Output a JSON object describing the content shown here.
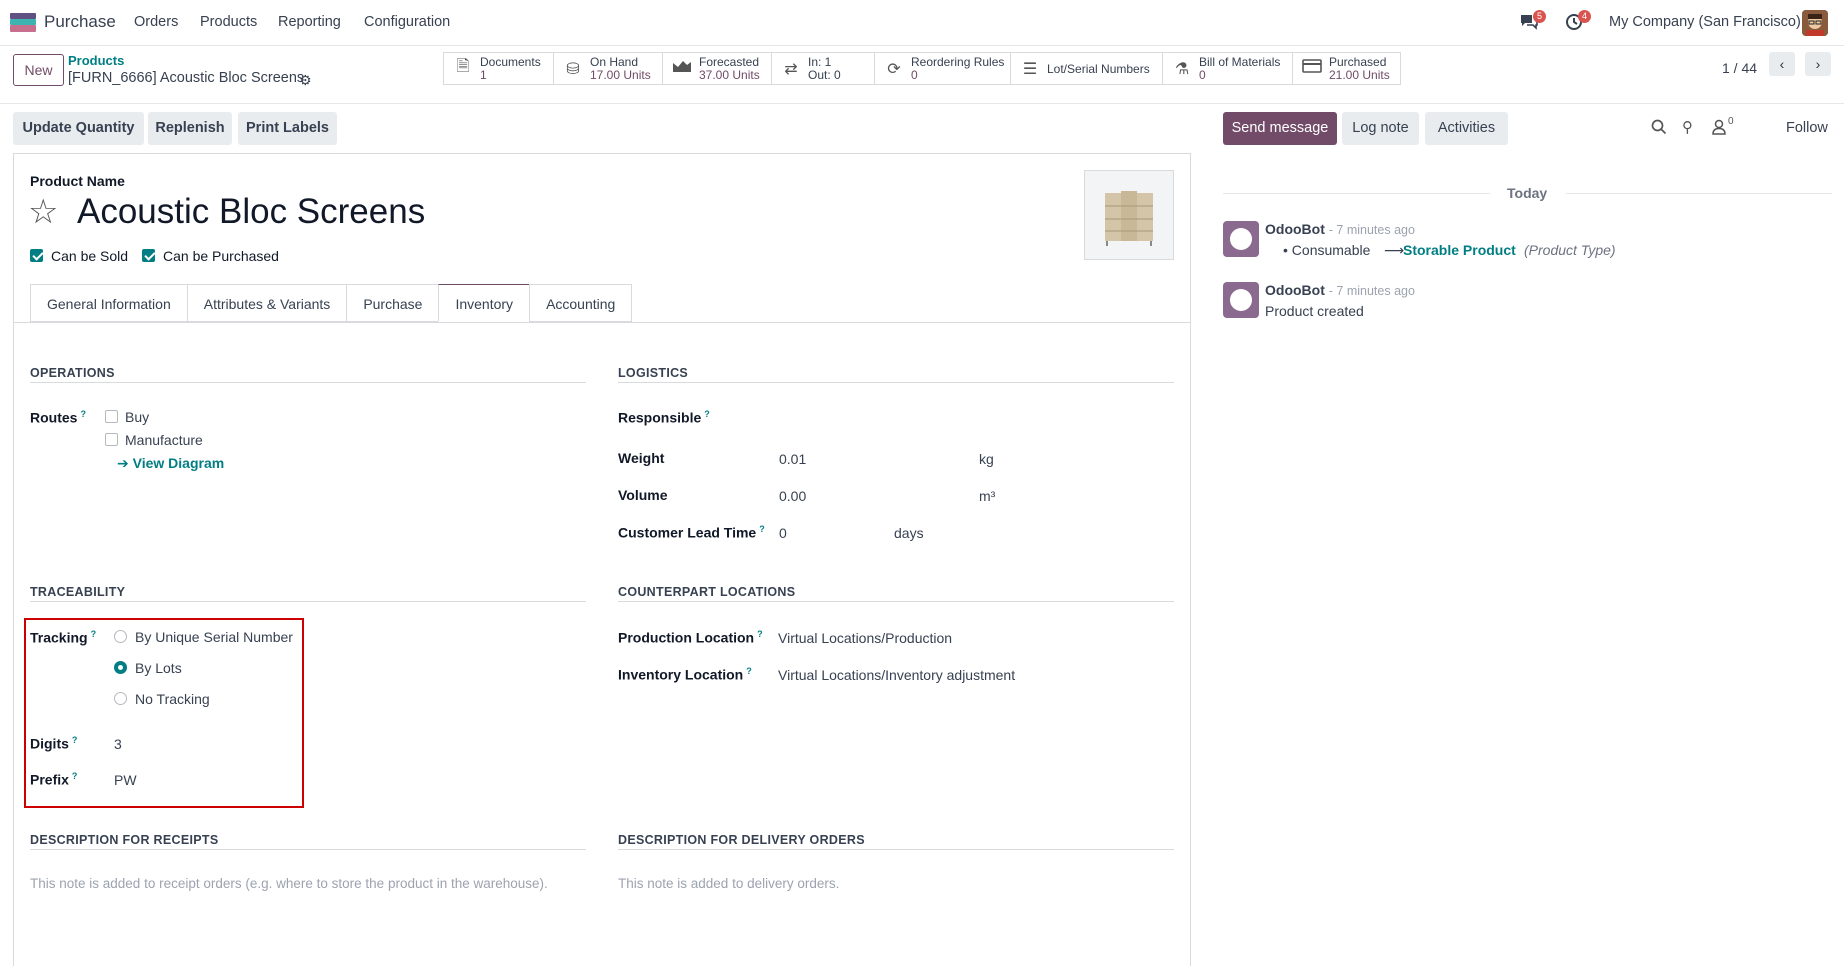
{
  "topbar": {
    "app_name": "Purchase",
    "menu": [
      "Orders",
      "Products",
      "Reporting",
      "Configuration"
    ],
    "messages_badge": "5",
    "activities_badge": "4",
    "company": "My Company (San Francisco)"
  },
  "control_panel": {
    "new_label": "New",
    "breadcrumb_parent": "Products",
    "breadcrumb_current": "[FURN_6666] Acoustic Bloc Screens",
    "smart_buttons": [
      {
        "label": "Documents",
        "value": "1",
        "icon": "document-icon"
      },
      {
        "label": "On Hand",
        "value": "17.00 Units",
        "icon": "cubes-icon"
      },
      {
        "label": "Forecasted",
        "value": "37.00 Units",
        "icon": "area-chart-icon"
      },
      {
        "label": "In: 1",
        "value": "Out: 0",
        "icon": "exchange-icon"
      },
      {
        "label": "Reordering Rules",
        "value": "0",
        "icon": "refresh-icon"
      },
      {
        "label": "Lot/Serial Numbers",
        "value": "",
        "icon": "list-icon"
      },
      {
        "label": "Bill of Materials",
        "value": "0",
        "icon": "flask-icon"
      },
      {
        "label": "Purchased",
        "value": "21.00 Units",
        "icon": "credit-card-icon"
      }
    ],
    "pager": "1 / 44"
  },
  "actions": {
    "update_quantity": "Update Quantity",
    "replenish": "Replenish",
    "print_labels": "Print Labels"
  },
  "product": {
    "name_label": "Product Name",
    "name": "Acoustic Bloc Screens",
    "can_be_sold": "Can be Sold",
    "can_be_purchased": "Can be Purchased"
  },
  "tabs": [
    "General Information",
    "Attributes & Variants",
    "Purchase",
    "Inventory",
    "Accounting"
  ],
  "operations": {
    "title": "OPERATIONS",
    "routes_label": "Routes",
    "route_buy": "Buy",
    "route_manufacture": "Manufacture",
    "view_diagram": "View Diagram"
  },
  "logistics": {
    "title": "LOGISTICS",
    "responsible_label": "Responsible",
    "weight_label": "Weight",
    "weight_value": "0.01",
    "weight_unit": "kg",
    "volume_label": "Volume",
    "volume_value": "0.00",
    "volume_unit": "m³",
    "lead_time_label": "Customer Lead Time",
    "lead_time_value": "0",
    "lead_time_unit": "days"
  },
  "traceability": {
    "title": "TRACEABILITY",
    "tracking_label": "Tracking",
    "option_serial": "By Unique Serial Number",
    "option_lots": "By Lots",
    "option_none": "No Tracking",
    "selected": "By Lots",
    "digits_label": "Digits",
    "digits_value": "3",
    "prefix_label": "Prefix",
    "prefix_value": "PW"
  },
  "counterpart": {
    "title": "COUNTERPART LOCATIONS",
    "production_label": "Production Location",
    "production_value": "Virtual Locations/Production",
    "inventory_label": "Inventory Location",
    "inventory_value": "Virtual Locations/Inventory adjustment"
  },
  "descriptions": {
    "receipts_title": "DESCRIPTION FOR RECEIPTS",
    "receipts_placeholder": "This note is added to receipt orders (e.g. where to store the product in the warehouse).",
    "delivery_title": "DESCRIPTION FOR DELIVERY ORDERS",
    "delivery_placeholder": "This note is added to delivery orders."
  },
  "chatter": {
    "send_message": "Send message",
    "log_note": "Log note",
    "activities": "Activities",
    "followers_count": "0",
    "follow": "Follow",
    "date_separator": "Today",
    "messages": [
      {
        "author": "OdooBot",
        "time": "- 7 minutes ago",
        "old_value": "Consumable",
        "new_value": "Storable Product",
        "field": "(Product Type)"
      },
      {
        "author": "OdooBot",
        "time": "- 7 minutes ago",
        "body": "Product created"
      }
    ]
  },
  "colors": {
    "brand": "#714B67",
    "accent": "#017e84",
    "highlight": "#cc0000"
  }
}
